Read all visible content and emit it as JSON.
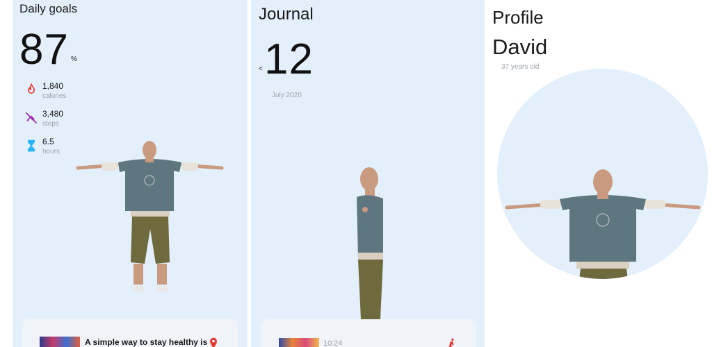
{
  "daily": {
    "title": "Daily goals",
    "percent": "87",
    "percent_unit": "%",
    "stats": [
      {
        "value": "1,840",
        "label": "calories",
        "icon": "flame-icon",
        "color": "#e53935"
      },
      {
        "value": "3,480",
        "label": "steps",
        "icon": "no-walking-icon",
        "color": "#9c27b0"
      },
      {
        "value": "6.5",
        "label": "hours",
        "icon": "hourglass-icon",
        "color": "#29b6f6"
      }
    ],
    "card": {
      "text": "A simple way to stay healthy is",
      "icon": "location-pin-icon"
    }
  },
  "journal": {
    "title": "Journal",
    "prev_arrow": "<",
    "day": "12",
    "month": "July 2020",
    "card": {
      "time": "10:24",
      "icon": "walking-icon"
    }
  },
  "profile": {
    "title": "Profile",
    "name": "David",
    "age": "37 years old"
  },
  "colors": {
    "panel_bg": "#e3f0fb",
    "circle_bg": "#e3f0fb",
    "card_bg": "#f0f3f8",
    "accent_red": "#e53935"
  }
}
